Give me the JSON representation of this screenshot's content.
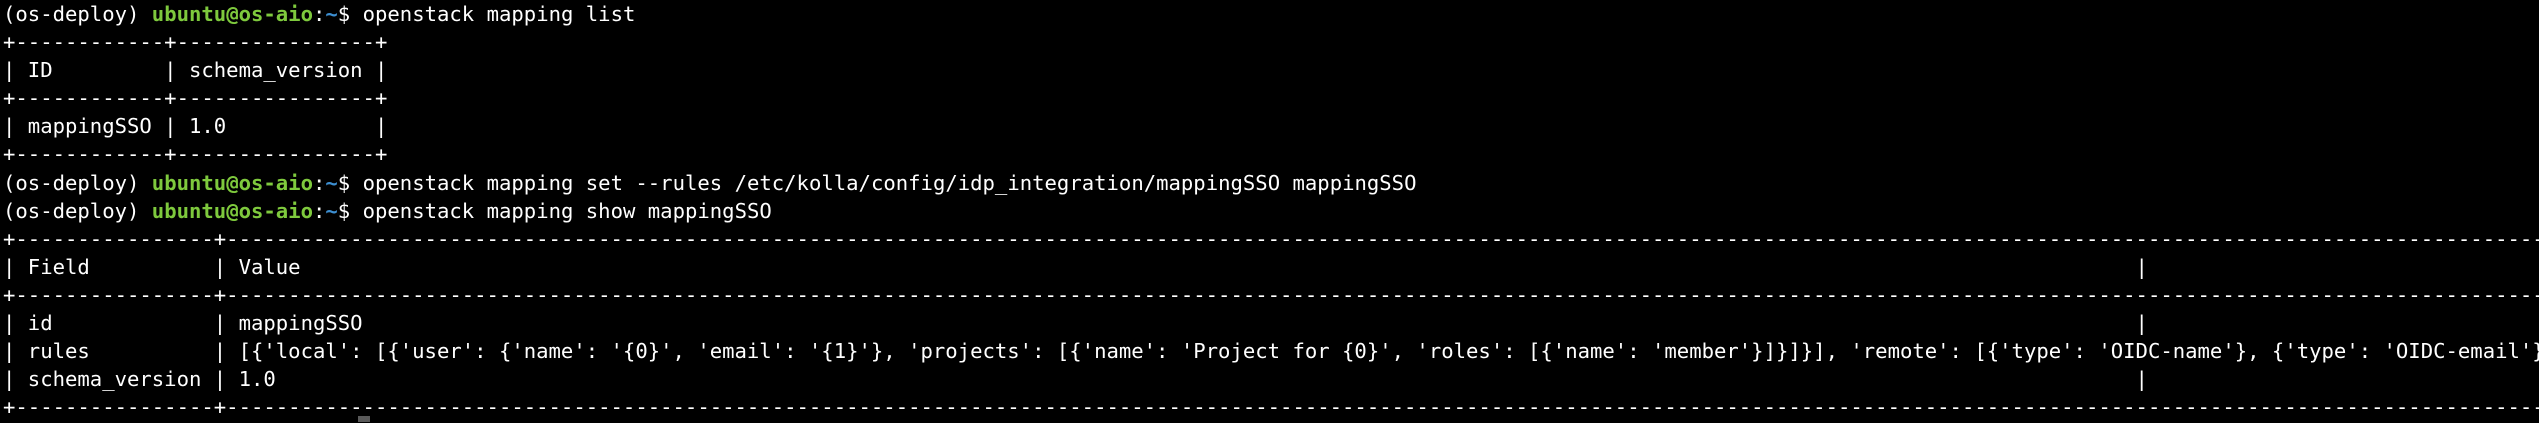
{
  "colors": {
    "background": "#000000",
    "text": "#ffffff",
    "prompt_user": "#7ec93d",
    "prompt_path": "#3d8fd1"
  },
  "prompt": {
    "env": "(os-deploy) ",
    "user_host": "ubuntu@os-aio",
    "colon": ":",
    "path": "~",
    "symbol": "$ "
  },
  "commands": {
    "cmd1": "openstack mapping list",
    "cmd2": "openstack mapping set --rules /etc/kolla/config/idp_integration/mappingSSO mappingSSO",
    "cmd3": "openstack mapping show mappingSSO"
  },
  "table1": {
    "border": "+------------+----------------+",
    "header": "| ID         | schema_version |",
    "rows": [
      "| mappingSSO | 1.0            |"
    ]
  },
  "table2": {
    "border": "+----------------+-----------------------------------------------------------------------------------------------------------------------------------------------------------------------------------------------------------------------------------------------------------------------------------------------------------------------------------------------------------------------------------------------------------------------------------------------------------------------------------------------------------------------------------------------------------------------------------------------+",
    "header": "| Field          | Value                                                                                                                                                    |",
    "rows": [
      "| id             | mappingSSO                                                                                                                                               |",
      "| rules          | [{'local': [{'user': {'name': '{0}', 'email': '{1}'}, 'projects': [{'name': 'Project for {0}', 'roles': [{'name': 'member'}]}]}], 'remote': [{'type': 'OIDC-name'}, {'type': 'OIDC-email'}]}] |",
      "| schema_version | 1.0                                                                                                                                                      |"
    ]
  }
}
